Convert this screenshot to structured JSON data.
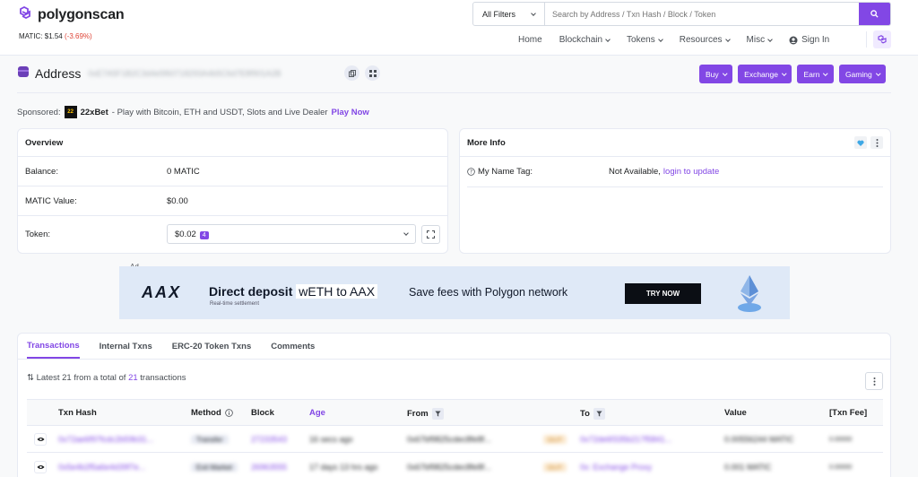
{
  "brand": {
    "name": "polygonscan",
    "accent": "#8247e5"
  },
  "price": {
    "label": "MATIC: $1.54",
    "change": "(-3.69%)"
  },
  "search": {
    "filter": "All Filters",
    "placeholder": "Search by Address / Txn Hash / Block / Token"
  },
  "nav": {
    "items": [
      "Home",
      "Blockchain",
      "Tokens",
      "Resources",
      "Misc"
    ],
    "signin": "Sign In"
  },
  "address": {
    "label": "Address",
    "hash": "0xE7A5F1B2C3d4e5f60718293A4b5C6d7E8f901A2B"
  },
  "header_buttons": [
    "Buy",
    "Exchange",
    "Earn",
    "Gaming"
  ],
  "sponsor": {
    "prefix": "Sponsored:",
    "logo_text": "22",
    "name": "22xBet",
    "text": "- Play with Bitcoin, ETH and USDT, Slots and Live Dealer",
    "link": "Play Now"
  },
  "overview": {
    "title": "Overview",
    "balance_label": "Balance:",
    "balance_value": "0 MATIC",
    "value_label": "MATIC Value:",
    "value_value": "$0.00",
    "token_label": "Token:",
    "token_value": "$0.02",
    "token_count": "4"
  },
  "more_info": {
    "title": "More Info",
    "name_tag_label": "My Name Tag:",
    "name_tag_value": "Not Available,",
    "name_tag_link": "login to update"
  },
  "ad": {
    "label": "Ad",
    "logo": "AAX",
    "headline": "Direct deposit",
    "highlight": "wETH to AAX",
    "tagline": "Save fees with Polygon network",
    "sub": "Real-time settlement",
    "cta": "TRY NOW"
  },
  "tabs": [
    "Transactions",
    "Internal Txns",
    "ERC-20 Token Txns",
    "Comments"
  ],
  "tx_summary": {
    "prefix": "Latest 21 from a total of",
    "count": "21",
    "suffix": "transactions"
  },
  "table": {
    "headers": {
      "hash": "Txn Hash",
      "method": "Method",
      "block": "Block",
      "age": "Age",
      "from": "From",
      "to": "To",
      "value": "Value",
      "fee": "[Txn Fee]"
    },
    "rows": [
      {
        "hash": "0x72ae6f97fcdc2b59b31...",
        "method": "Transfer",
        "block": "27233543",
        "age": "16 secs ago",
        "from": "0x67bf9825cdec8fe8f...",
        "dir": "OUT",
        "to": "0x72de6f335b217f5841...",
        "value": "0.00556244 MATIC",
        "fee": "0.00000"
      },
      {
        "hash": "0x5e4b2f5a6e4d39f7e...",
        "method": "Exit Market",
        "block": "26963555",
        "age": "17 days 13 hrs ago",
        "from": "0x67bf9825cdec8fe8f...",
        "dir": "OUT",
        "to": "0x: Exchange Proxy",
        "value": "0.001 MATIC",
        "fee": "0.00000"
      }
    ]
  }
}
